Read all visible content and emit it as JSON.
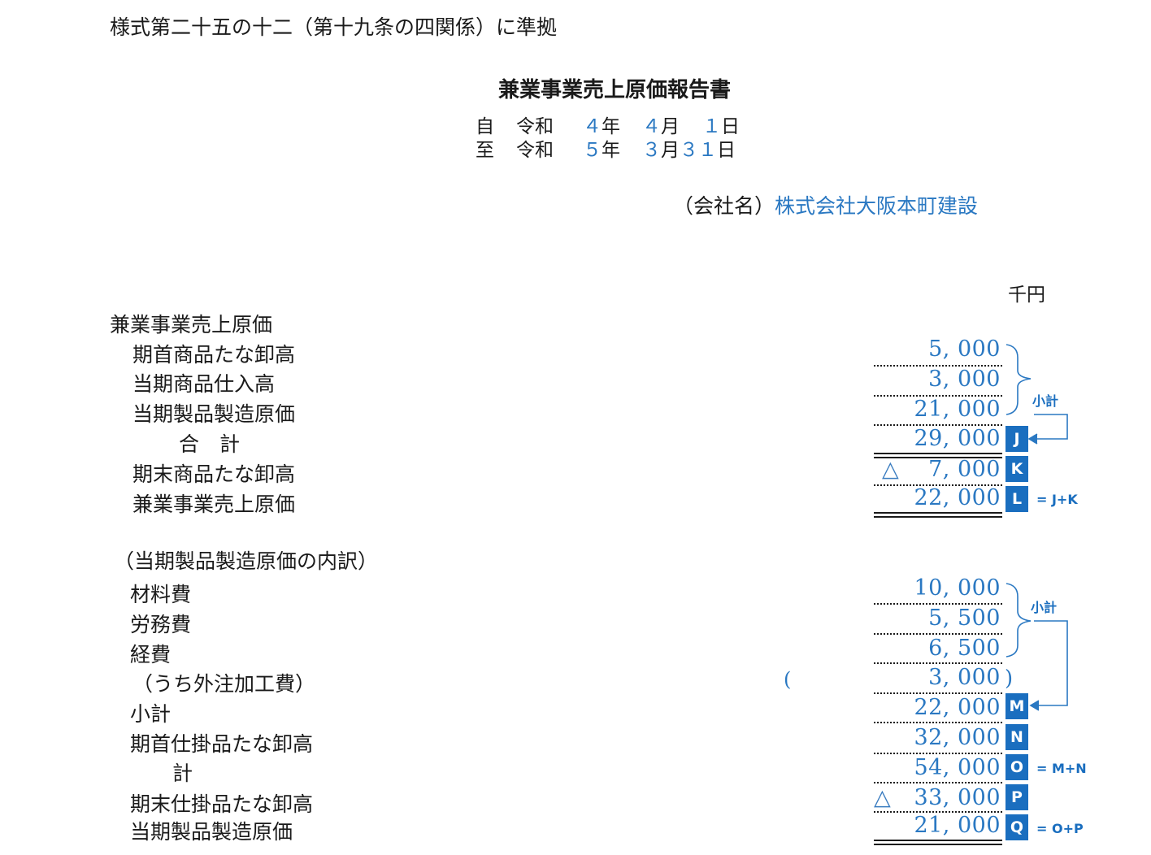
{
  "header": {
    "form_reference": "様式第二十五の十二（第十九条の四関係）に準拠",
    "title": "兼業事業売上原価報告書",
    "period_from": {
      "prefix": "自",
      "era": "令和",
      "year": "４",
      "year_unit": "年",
      "month": "４",
      "month_unit": "月",
      "day": "１",
      "day_unit": "日"
    },
    "period_to": {
      "prefix": "至",
      "era": "令和",
      "year": "５",
      "year_unit": "年",
      "month": "３",
      "month_unit": "月",
      "day": "３１",
      "day_unit": "日"
    },
    "company_label": "（会社名）",
    "company_name": "株式会社大阪本町建設",
    "unit": "千円"
  },
  "cost_section": {
    "heading": "兼業事業売上原価",
    "rows": [
      {
        "label": "期首商品たな卸高",
        "amount": "5, 000",
        "triangle": "",
        "badge": ""
      },
      {
        "label": "当期商品仕入高",
        "amount": "3, 000",
        "triangle": "",
        "badge": ""
      },
      {
        "label": "当期製品製造原価",
        "amount": "21, 000",
        "triangle": "",
        "badge": ""
      },
      {
        "label": "合　計",
        "amount": "29, 000",
        "triangle": "",
        "badge": "J"
      },
      {
        "label": "期末商品たな卸高",
        "amount": "7, 000",
        "triangle": "△",
        "badge": "K"
      },
      {
        "label": "兼業事業売上原価",
        "amount": "22, 000",
        "triangle": "",
        "badge": "L"
      }
    ],
    "subtotal_note": "小計",
    "formula_l": "= J+K"
  },
  "breakdown_section": {
    "heading": "（当期製品製造原価の内訳）",
    "rows": [
      {
        "label": "材料費",
        "amount": "10, 000",
        "triangle": "",
        "badge": ""
      },
      {
        "label": "労務費",
        "amount": "5, 500",
        "triangle": "",
        "badge": ""
      },
      {
        "label": "経費",
        "amount": "6, 500",
        "triangle": "",
        "badge": ""
      },
      {
        "label": "（うち外注加工費）",
        "amount": "3, 000",
        "triangle": "",
        "badge": ""
      },
      {
        "label": "小計",
        "amount": "22, 000",
        "triangle": "",
        "badge": "M"
      },
      {
        "label": "期首仕掛品たな卸高",
        "amount": "32, 000",
        "triangle": "",
        "badge": "N"
      },
      {
        "label": "計",
        "amount": "54, 000",
        "triangle": "",
        "badge": "O"
      },
      {
        "label": "期末仕掛品たな卸高",
        "amount": "33, 000",
        "triangle": "△",
        "badge": "P"
      },
      {
        "label": "当期製品製造原価",
        "amount": "21, 000",
        "triangle": "",
        "badge": "Q"
      }
    ],
    "paren_open": "(",
    "paren_close": ")",
    "subtotal_note": "小計",
    "formula_o": "= M+N",
    "formula_q": "= O+P"
  },
  "colors": {
    "value_blue": "#2a78c2",
    "badge_blue": "#1a6ebf",
    "text": "#1a1a1a"
  }
}
